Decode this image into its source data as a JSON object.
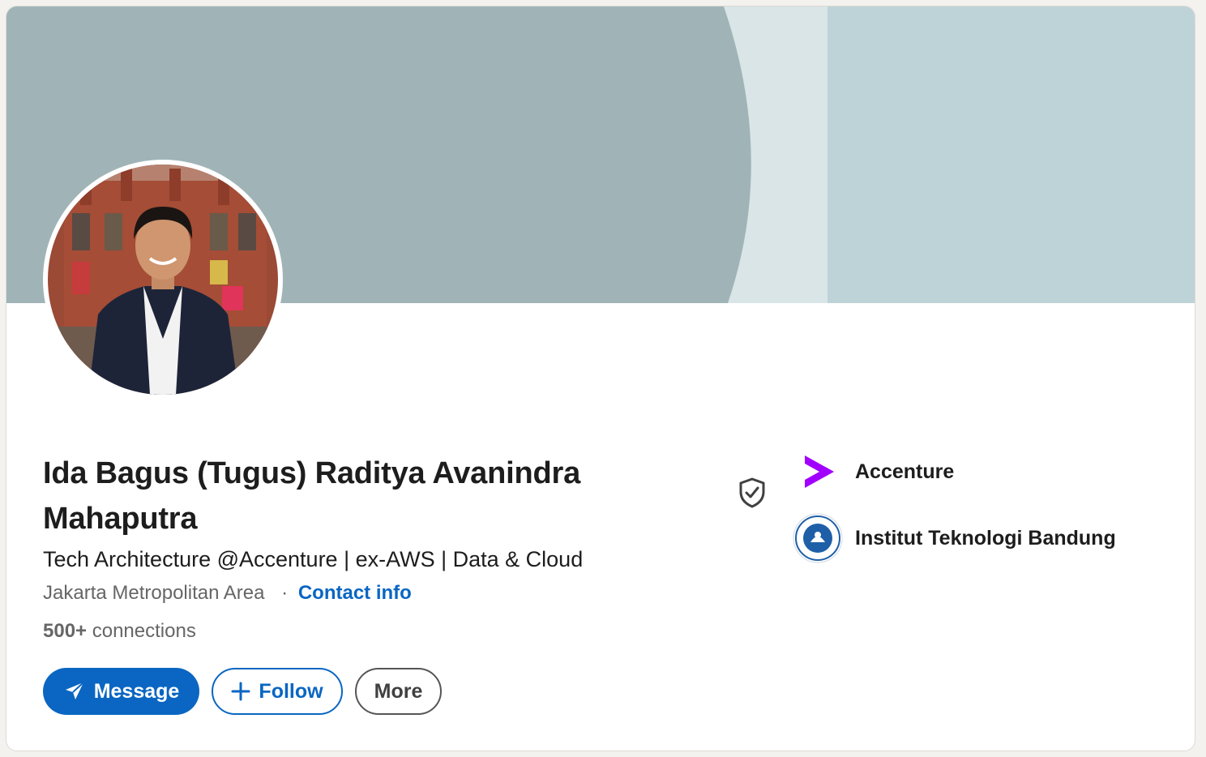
{
  "profile": {
    "name": "Ida Bagus (Tugus) Raditya Avanindra Mahaputra",
    "headline": "Tech Architecture @Accenture | ex-AWS | Data & Cloud",
    "location": "Jakarta Metropolitan Area",
    "separator": "·",
    "contact_info_label": "Contact info",
    "connections_count": "500+",
    "connections_label": "connections"
  },
  "actions": {
    "message_label": "Message",
    "follow_label": "Follow",
    "more_label": "More"
  },
  "organizations": [
    {
      "name": "Accenture",
      "icon": "accenture-logo"
    },
    {
      "name": "Institut Teknologi Bandung",
      "icon": "itb-logo"
    }
  ],
  "icons": {
    "verified": "shield-check-icon",
    "message": "paper-plane-icon",
    "follow": "plus-icon"
  },
  "colors": {
    "primary": "#0a66c2",
    "banner_dark": "#a0b4b7",
    "banner_light": "#bed3d7",
    "banner_band": "#d9e5e7",
    "accenture_purple": "#a100ff",
    "itb_blue": "#1f5fa8"
  }
}
